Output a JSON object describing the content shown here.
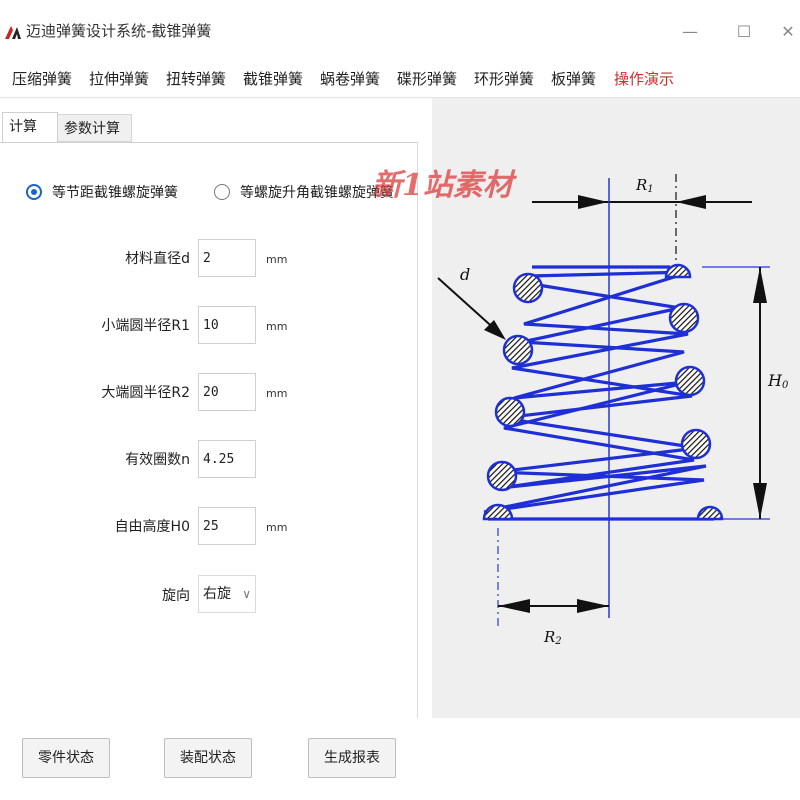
{
  "window": {
    "title": "迈迪弹簧设计系统-截锥弹簧",
    "minimize": "—",
    "maximize": "☐",
    "close": "✕"
  },
  "menu": [
    "压缩弹簧",
    "拉伸弹簧",
    "扭转弹簧",
    "截锥弹簧",
    "蜗卷弹簧",
    "碟形弹簧",
    "环形弹簧",
    "板弹簧",
    "操作演示"
  ],
  "colors": {
    "accent": "#1566c9",
    "menu_highlight": "#d12b2b",
    "spring": "#1f2fd6"
  },
  "tabs": {
    "calc": "计算",
    "param": "参数计算"
  },
  "radios": [
    {
      "label": "等节距截锥螺旋弹簧",
      "checked": true
    },
    {
      "label": "等螺旋升角截锥螺旋弹簧",
      "checked": false
    }
  ],
  "fields": {
    "d": {
      "label": "材料直径d",
      "value": "2",
      "unit": "mm"
    },
    "r1": {
      "label": "小端圆半径R1",
      "value": "10",
      "unit": "mm"
    },
    "r2": {
      "label": "大端圆半径R2",
      "value": "20",
      "unit": "mm"
    },
    "n": {
      "label": "有效圈数n",
      "value": "4.25"
    },
    "h0": {
      "label": "自由高度H0",
      "value": "25",
      "unit": "mm"
    },
    "dir": {
      "label": "旋向",
      "value": "右旋"
    }
  },
  "diagram": {
    "label_d": "d",
    "label_r1": "R",
    "label_r1_sub": "1",
    "label_r2": "R",
    "label_r2_sub": "2",
    "label_h0": "H",
    "label_h0_sub": "0"
  },
  "watermark": "新1站素材",
  "buttons": {
    "part_state": "零件状态",
    "assembly_state": "装配状态",
    "report": "生成报表"
  }
}
